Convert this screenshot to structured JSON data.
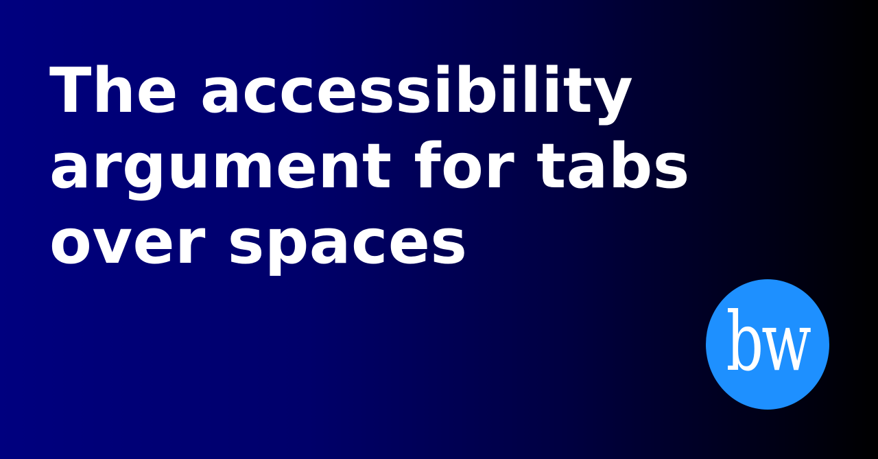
{
  "title": "The accessibility argument for tabs over spaces",
  "logo": {
    "text": "bw",
    "color": "#1e90ff"
  },
  "colors": {
    "background_start": "#00007f",
    "background_end": "#000000",
    "text": "#ffffff"
  }
}
